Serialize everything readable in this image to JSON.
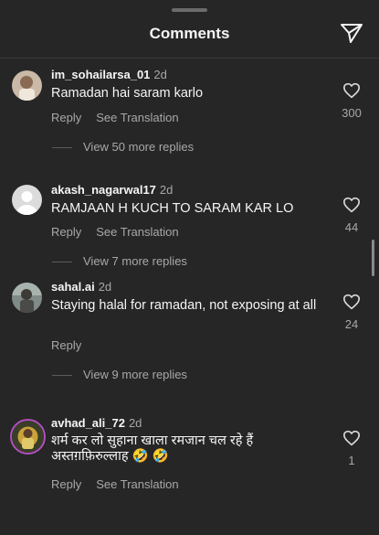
{
  "header": {
    "title": "Comments"
  },
  "comments": [
    {
      "username": "im_sohailarsa_01",
      "time": "2d",
      "text": "Ramadan hai saram karlo",
      "reply": "Reply",
      "translate": "See Translation",
      "likes": "300",
      "view_replies": "View 50 more replies"
    },
    {
      "username": "akash_nagarwal17",
      "time": "2d",
      "text": "RAMJAAN H KUCH TO SARAM KAR LO",
      "reply": "Reply",
      "translate": "See Translation",
      "likes": "44",
      "view_replies": "View 7 more replies"
    },
    {
      "username": "sahal.ai",
      "time": "2d",
      "text": "Staying halal for ramadan, not exposing at all",
      "reply": "Reply",
      "likes": "24",
      "view_replies": "View 9 more replies"
    },
    {
      "username": "avhad_ali_72",
      "time": "2d",
      "text": "शर्म कर लो सुहाना खाला रमजान चल रहे हैं अस्तग़फ़िरुल्लाह 🤣 🤣",
      "reply": "Reply",
      "translate": "See Translation",
      "likes": "1"
    }
  ],
  "colors": {
    "background": "#262626",
    "text": "#f5f5f5",
    "secondary": "#a8a8a8"
  }
}
